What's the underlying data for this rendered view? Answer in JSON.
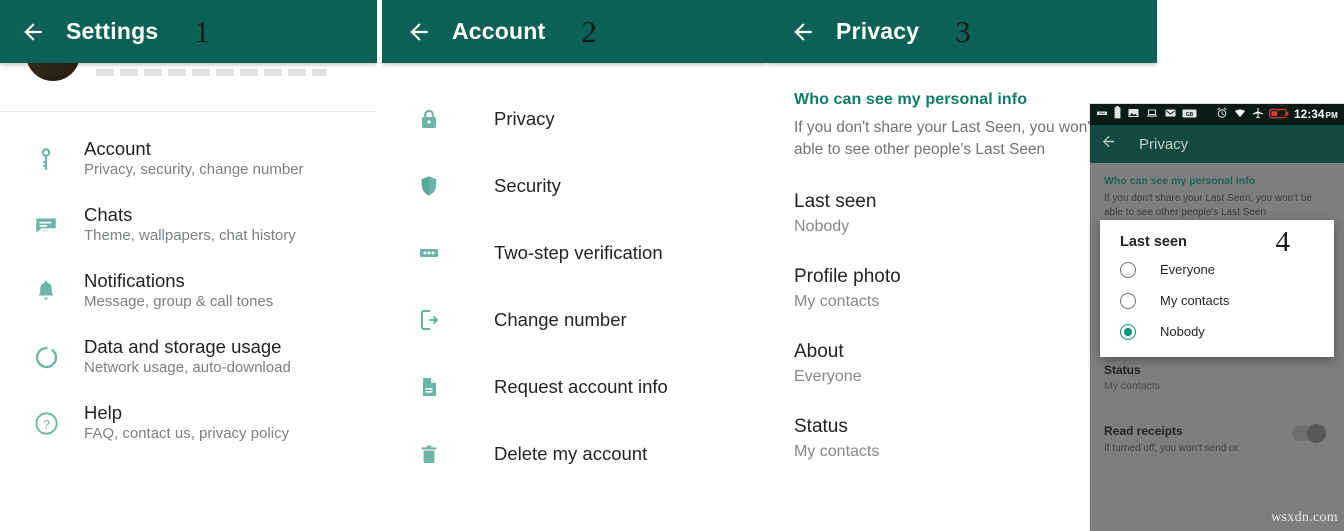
{
  "panels": {
    "settings": {
      "title": "Settings",
      "step": "1",
      "back_icon": "back-arrow-icon",
      "items": [
        {
          "icon": "key-icon",
          "title": "Account",
          "subtitle": "Privacy, security, change number"
        },
        {
          "icon": "chat-icon",
          "title": "Chats",
          "subtitle": "Theme, wallpapers, chat history"
        },
        {
          "icon": "bell-icon",
          "title": "Notifications",
          "subtitle": "Message, group & call tones"
        },
        {
          "icon": "data-icon",
          "title": "Data and storage usage",
          "subtitle": "Network usage, auto-download"
        },
        {
          "icon": "help-icon",
          "title": "Help",
          "subtitle": "FAQ, contact us, privacy policy"
        }
      ]
    },
    "account": {
      "title": "Account",
      "step": "2",
      "items": [
        {
          "icon": "lock-icon",
          "label": "Privacy"
        },
        {
          "icon": "shield-icon",
          "label": "Security"
        },
        {
          "icon": "dots-icon",
          "label": "Two-step verification"
        },
        {
          "icon": "phone-out-icon",
          "label": "Change number"
        },
        {
          "icon": "document-icon",
          "label": "Request account info"
        },
        {
          "icon": "trash-icon",
          "label": "Delete my account"
        }
      ]
    },
    "privacy": {
      "title": "Privacy",
      "step": "3",
      "section_header": "Who can see my personal info",
      "section_desc": "If you don't share your Last Seen, you won't be able to see other people's Last Seen",
      "items": [
        {
          "title": "Last seen",
          "value": "Nobody"
        },
        {
          "title": "Profile photo",
          "value": "My contacts"
        },
        {
          "title": "About",
          "value": "Everyone"
        },
        {
          "title": "Status",
          "value": "My contacts"
        }
      ]
    },
    "phone": {
      "statusbar": {
        "icons": [
          "dots-icon",
          "battery-icon",
          "image-icon",
          "laptop-icon",
          "gmail-icon",
          "gb-icon",
          "alarm-icon",
          "wifi-icon",
          "airplane-icon",
          "battery-low-icon"
        ],
        "clock": "12:34",
        "meridiem": "PM"
      },
      "title": "Privacy",
      "section_header": "Who can see my personal info",
      "section_desc": "If you don't share your Last Seen, you won't be able to see other people's Last Seen",
      "dialog": {
        "step": "4",
        "title": "Last seen",
        "options": [
          {
            "label": "Everyone",
            "selected": false
          },
          {
            "label": "My contacts",
            "selected": false
          },
          {
            "label": "Nobody",
            "selected": true
          }
        ]
      },
      "below": [
        {
          "title": "Status",
          "value": "My contacts"
        }
      ],
      "read_receipts": {
        "title": "Read receipts",
        "desc": "If turned off, you won't send or",
        "toggle_on": false
      }
    }
  },
  "watermark": "wsxdn.com",
  "colors": {
    "appbar_green": "#0c6157",
    "icon_green": "#6cb5a4",
    "accent_teal": "#0f7c66",
    "radio_on": "#00937a"
  }
}
